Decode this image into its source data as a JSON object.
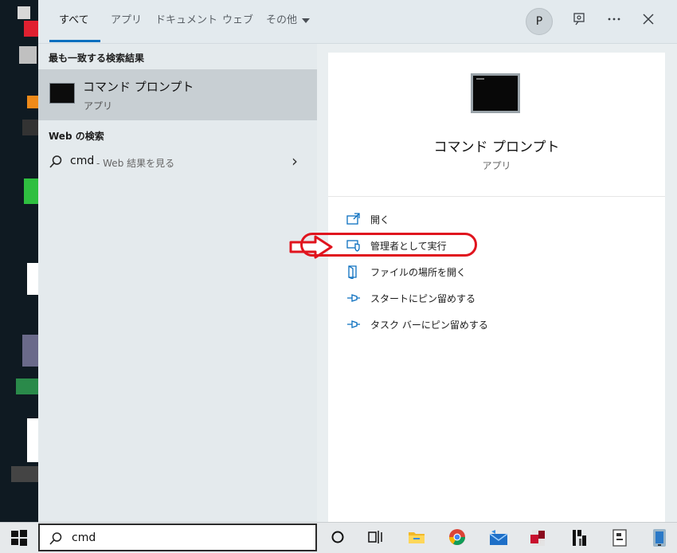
{
  "tabs": [
    {
      "label": "すべて",
      "active": true
    },
    {
      "label": "アプリ"
    },
    {
      "label": "ドキュメント"
    },
    {
      "label": "ウェブ"
    },
    {
      "label": "その他"
    }
  ],
  "header": {
    "avatar_initial": "P",
    "icons": [
      "feedback-icon",
      "more-icon",
      "close-icon"
    ]
  },
  "best_match": {
    "section_title": "最も一致する検索結果",
    "name": "コマンド プロンプト",
    "type": "アプリ"
  },
  "web": {
    "section_title": "Web の検索",
    "query": "cmd",
    "suffix": "- Web 結果を見る"
  },
  "detail": {
    "name": "コマンド プロンプト",
    "type": "アプリ",
    "actions": [
      {
        "label": "開く",
        "icon": "open-icon"
      },
      {
        "label": "管理者として実行",
        "icon": "shield-icon"
      },
      {
        "label": "ファイルの場所を開く",
        "icon": "file-location-icon"
      },
      {
        "label": "スタートにピン留めする",
        "icon": "pin-icon"
      },
      {
        "label": "タスク バーにピン留めする",
        "icon": "pin-icon"
      }
    ]
  },
  "taskbar": {
    "search_value": "cmd",
    "icons": [
      "windows-start-icon",
      "cortana-icon",
      "task-view-icon",
      "file-explorer-icon",
      "chrome-icon",
      "mail-icon",
      "app-icon",
      "app-icon",
      "app-icon",
      "app-icon"
    ]
  },
  "colors": {
    "accent": "#0b6fbf",
    "highlight": "#e0141e"
  }
}
